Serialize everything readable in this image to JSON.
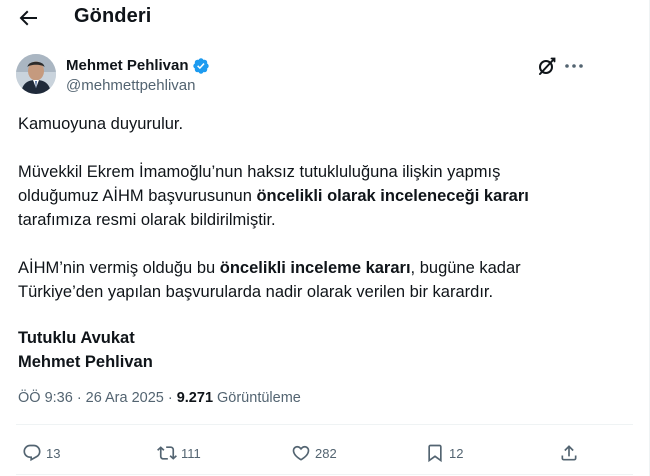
{
  "header": {
    "title": "Gönderi",
    "back_icon": "arrow-left-icon"
  },
  "post": {
    "author": {
      "name": "Mehmet Pehlivan",
      "handle": "@mehmettpehlivan",
      "verified": true,
      "verified_color": "#1d9bf0"
    },
    "text": {
      "p1": "Kamuoyuna duyurulur.",
      "p2a": "Müvekkil Ekrem İmamoğlu’nun haksız tutukluluğuna ilişkin yapmış",
      "p2b": "olduğumuz AİHM başvurusunun ",
      "p2b_bold": "öncelikli olarak inceleneceği kararı",
      "p2c": "tarafımıza resmi olarak bildirilmiştir.",
      "p3a": "AİHM’nin vermiş olduğu bu ",
      "p3a_bold": "öncelikli inceleme kararı",
      "p3a_end": ", bugüne kadar",
      "p3b": "Türkiye’den yapılan başvurularda nadir olarak verilen bir karardır.",
      "sig1": "Tutuklu Avukat",
      "sig2": "Mehmet Pehlivan"
    },
    "meta": {
      "time": "ÖÖ 9:36",
      "sep": "·",
      "date": "26 Ara 2025",
      "views": "9.271",
      "views_label": "Görüntüleme"
    },
    "actions": {
      "replies": "13",
      "reposts": "111",
      "likes": "282",
      "bookmarks": "12"
    }
  },
  "colors": {
    "text": "#0f1419",
    "muted": "#536471",
    "divider": "#eff3f4",
    "accent": "#1d9bf0"
  }
}
